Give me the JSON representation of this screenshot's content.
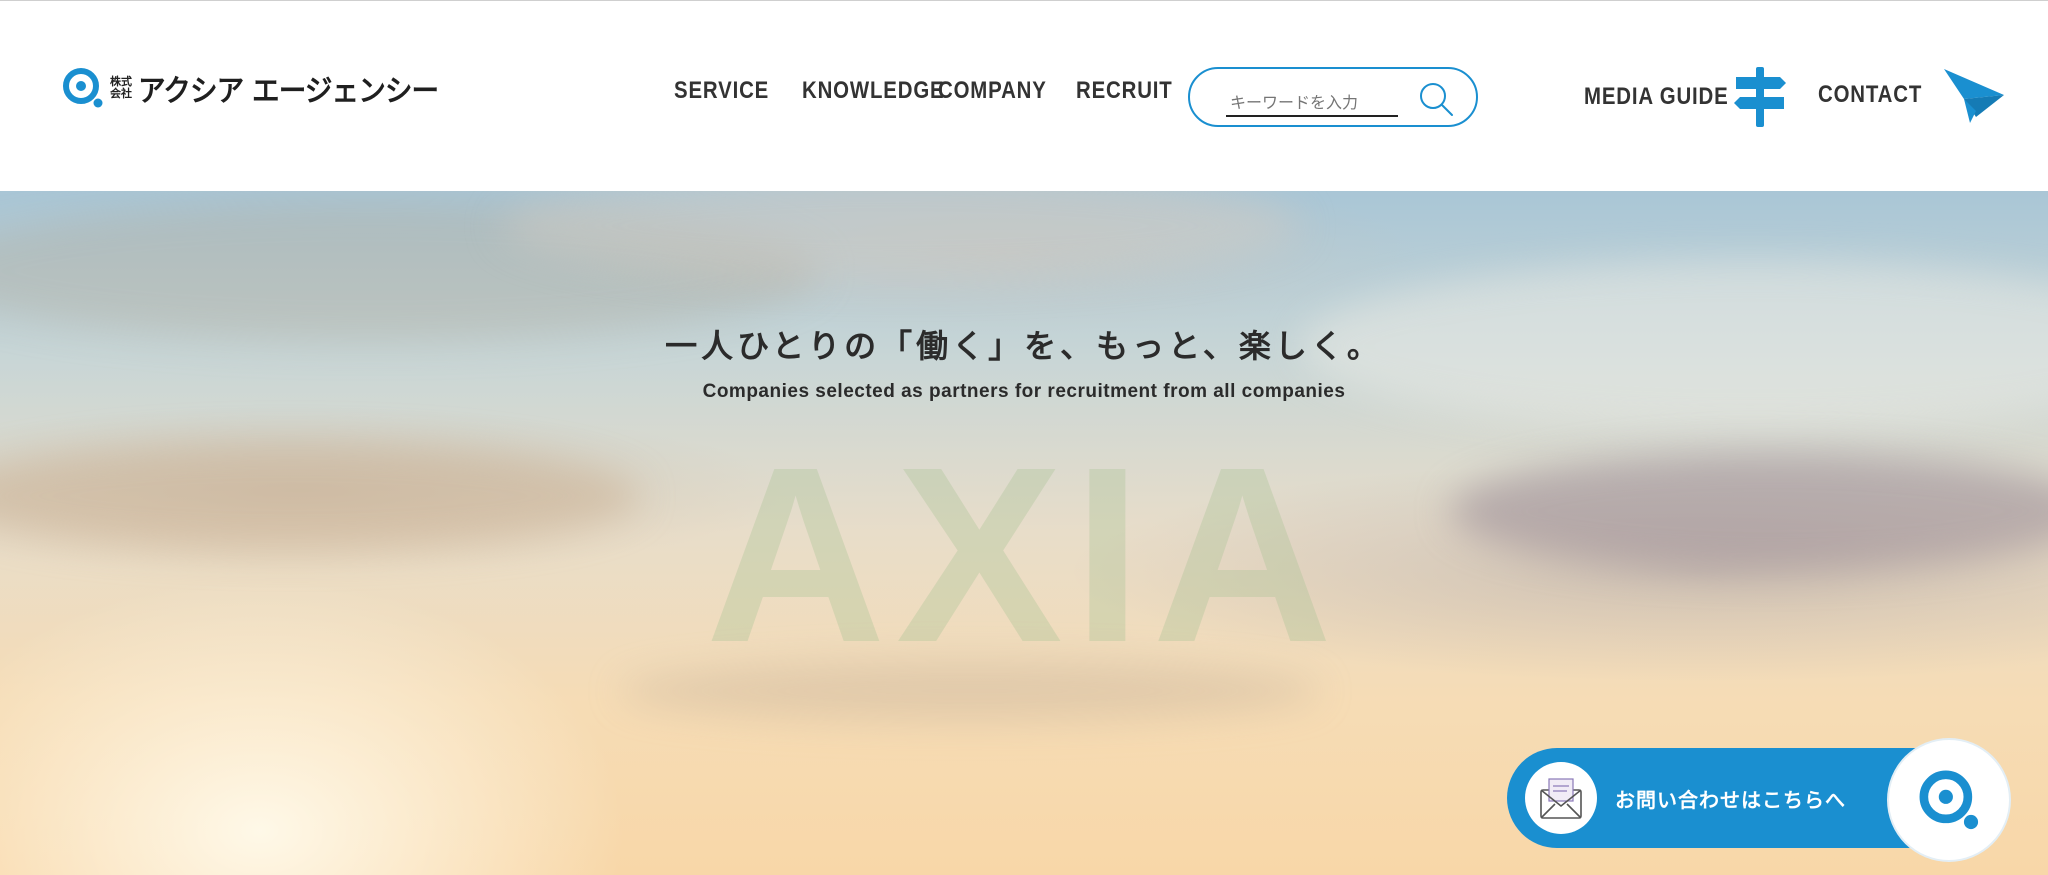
{
  "brand": {
    "kabushiki": "株式会社",
    "name": "アクシア エージェンシー",
    "accent": "#1a8fd0"
  },
  "nav": {
    "items": [
      "SERVICE",
      "KNOWLEDGE",
      "COMPANY",
      "RECRUIT"
    ]
  },
  "search": {
    "placeholder": "キーワードを入力",
    "icon": "search-icon"
  },
  "header_links": {
    "media_guide": "MEDIA GUIDE",
    "contact": "CONTACT"
  },
  "hero": {
    "title": "一人ひとりの「働く」を、もっと、楽しく。",
    "subtitle": "Companies selected as partners for recruitment from all companies",
    "watermark": "AXIA"
  },
  "floating_contact": {
    "label": "お問い合わせはこちらへ",
    "icon": "mail-icon"
  }
}
